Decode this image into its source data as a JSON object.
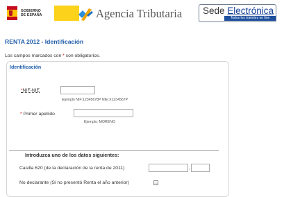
{
  "header": {
    "gobierno_logo_text": [
      "GOBIERNO",
      "DE ESPAÑA"
    ],
    "agency_name": "Agencia Tributaria",
    "sede_title_prefix": "Sede ",
    "sede_title_link": "Electrónica",
    "sede_subtitle": "Todos los trámites on line"
  },
  "page": {
    "title": "RENTA 2012 - Identificación",
    "required_note_prefix": "Los campos marcados con ",
    "required_star": "*",
    "required_note_suffix": " son obligatorios."
  },
  "panel": {
    "legend": "Identificación",
    "nif": {
      "star": "*",
      "label": "NIF-NIE",
      "value": "",
      "example": "Ejemplo NIF:12345678P NIE:X1234567P"
    },
    "apellido": {
      "star": "* ",
      "label": "Primer apellido",
      "value": "",
      "example": "Ejemplo: MORENO"
    },
    "section_heading": "Introduzca uno de los datos siguientes:",
    "casilla": {
      "label": "Casilla 620 (de la declaración de la renta de 2011)",
      "integer_value": "",
      "separator": ",",
      "decimal_value": ""
    },
    "no_declarante": {
      "label": "No declarante (Si no presentó Renta el año anterior)",
      "checked": false
    }
  },
  "colors": {
    "title_blue": "#1d5aa9",
    "required_red": "#d40000",
    "gobierno_yellow": "#fcd21a",
    "sede_blue": "#1d4f9e"
  }
}
